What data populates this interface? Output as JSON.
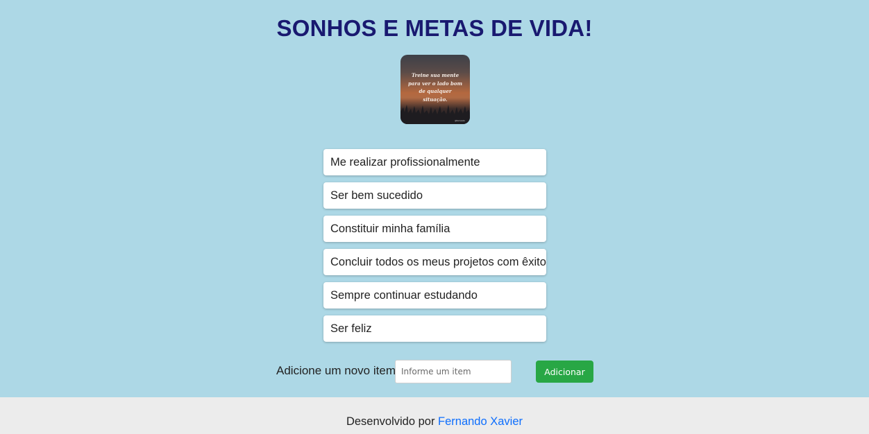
{
  "header": {
    "title": "SONHOS E METAS DE VIDA!"
  },
  "image": {
    "quote": "Treine sua mente\npara ver o lado bom\nde qualquer\nsituação.",
    "signature": "@fernando"
  },
  "goals": {
    "items": [
      "Me realizar profissionalmente",
      "Ser bem sucedido",
      "Constituir minha família",
      "Concluir todos os meus projetos com êxito",
      "Sempre continuar estudando",
      "Ser feliz"
    ]
  },
  "add_form": {
    "label": "Adicione um novo item:",
    "placeholder": "Informe um item",
    "button_label": "Adicionar"
  },
  "footer": {
    "text": "Desenvolvido por",
    "author": "Fernando Xavier"
  },
  "colors": {
    "background": "#add8e6",
    "title": "#191970",
    "button": "#28a745",
    "link": "#0d6efd",
    "footer_bg": "#ececec"
  }
}
